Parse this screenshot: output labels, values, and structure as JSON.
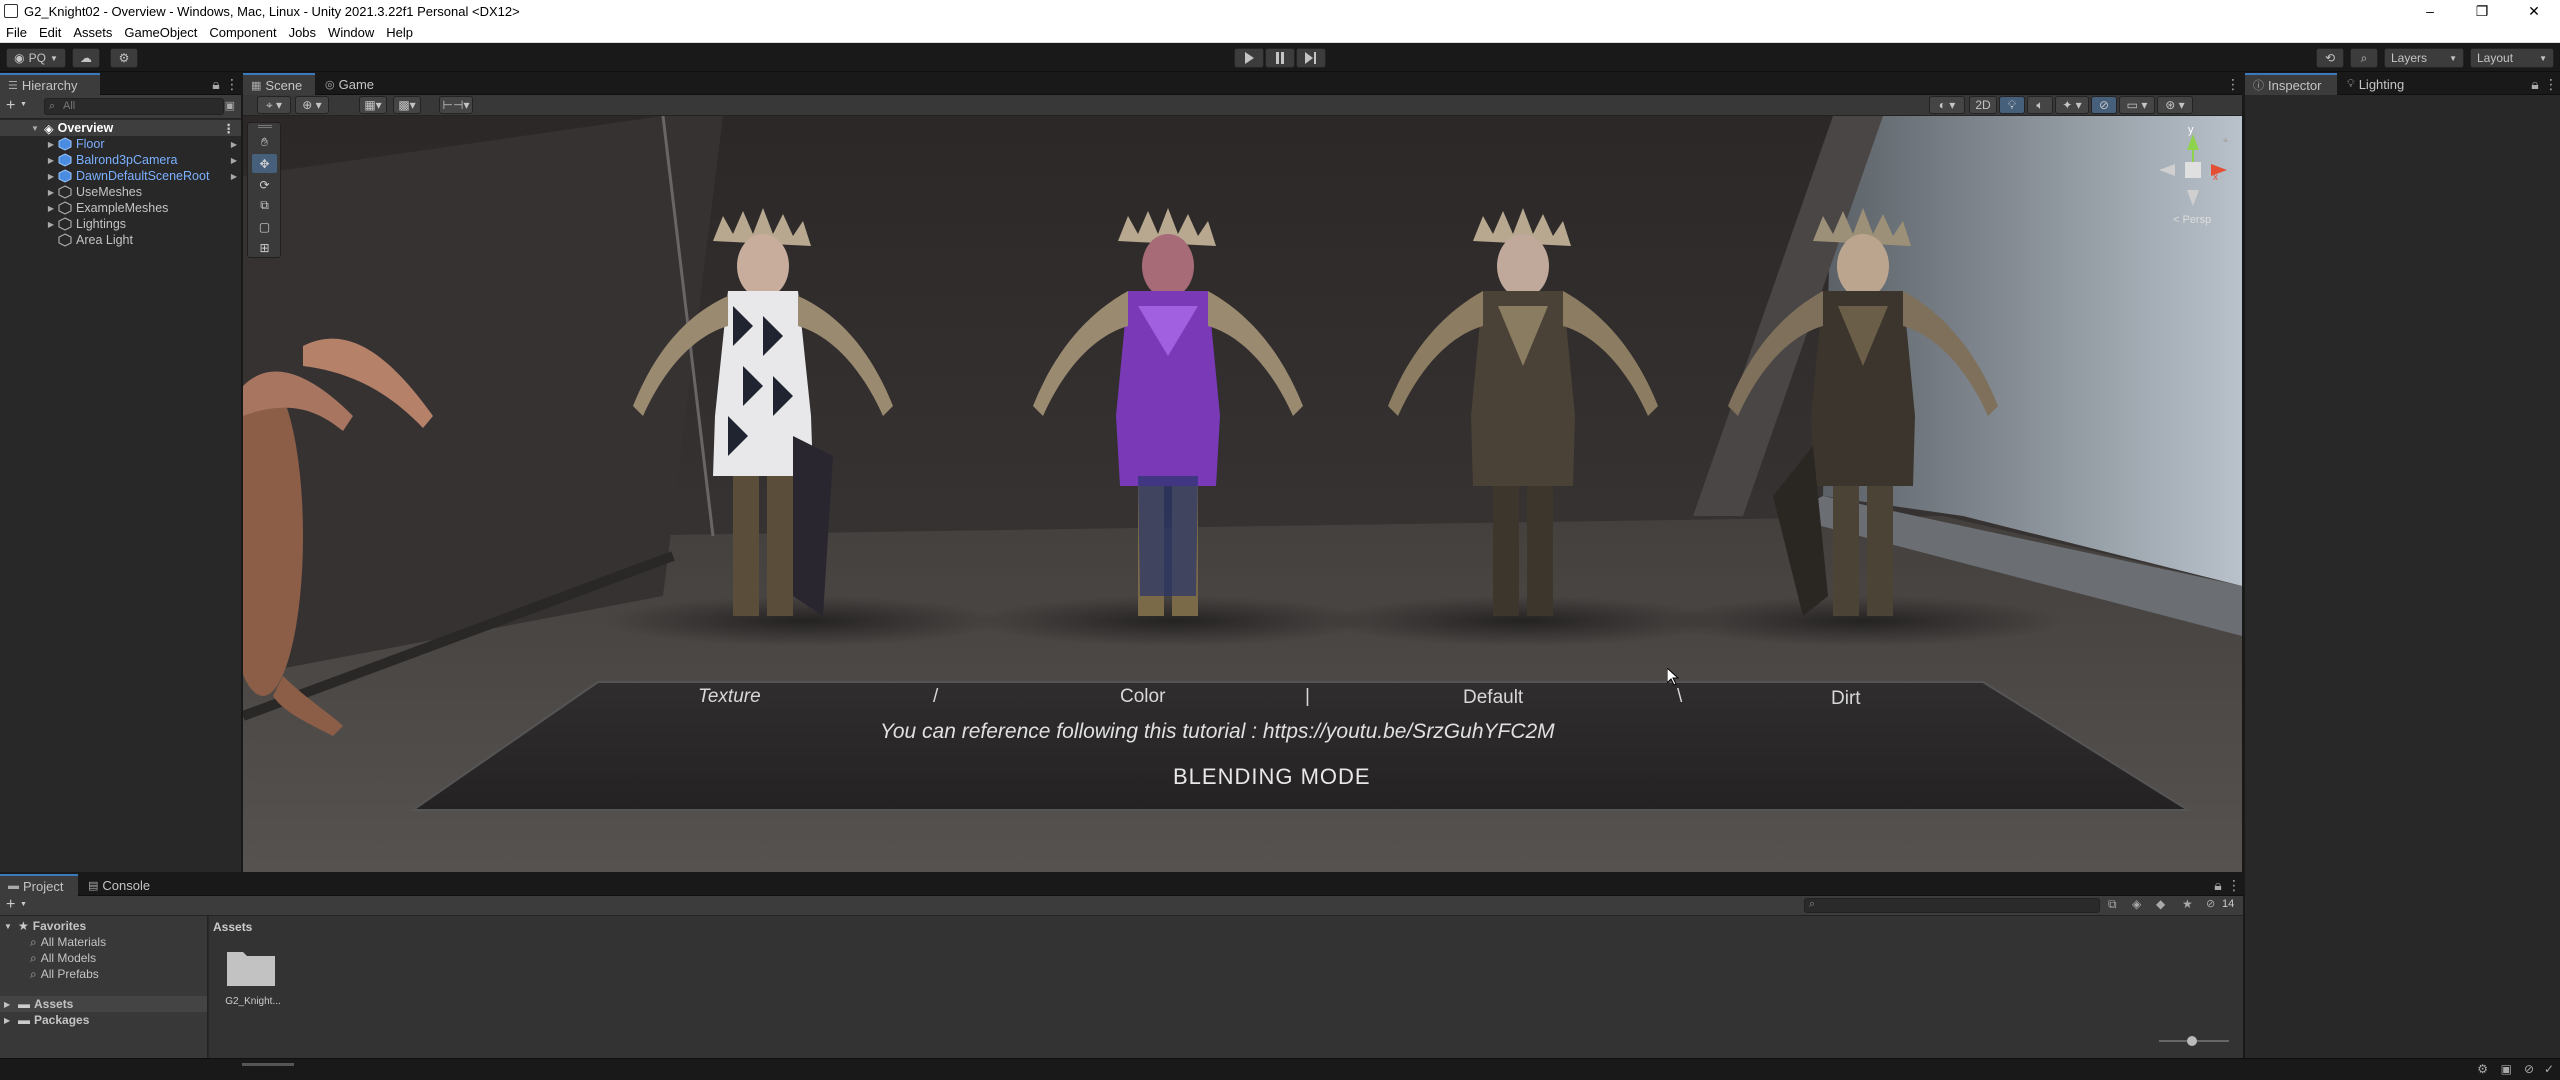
{
  "titlebar": {
    "title": "G2_Knight02 - Overview - Windows, Mac, Linux - Unity 2021.3.22f1 Personal <DX12>",
    "minimize": "–",
    "maximize": "❐",
    "close": "✕"
  },
  "menu": [
    "File",
    "Edit",
    "Assets",
    "GameObject",
    "Component",
    "Jobs",
    "Window",
    "Help"
  ],
  "toolbar": {
    "account_label": "PQ",
    "layers_label": "Layers",
    "layout_label": "Layout"
  },
  "hierarchy": {
    "tab_label": "Hierarchy",
    "search_placeholder": "All",
    "scene_name": "Overview",
    "items": [
      {
        "label": "Floor",
        "prefab": true
      },
      {
        "label": "Balrond3pCamera",
        "prefab": true
      },
      {
        "label": "DawnDefaultSceneRoot",
        "prefab": true
      },
      {
        "label": "UseMeshes",
        "prefab": false
      },
      {
        "label": "ExampleMeshes",
        "prefab": false
      },
      {
        "label": "Lightings",
        "prefab": false
      },
      {
        "label": "Area Light",
        "prefab": false
      }
    ]
  },
  "scene": {
    "tabs": [
      "Scene",
      "Game"
    ],
    "btn_2d": "2D",
    "gizmo_y": "y",
    "gizmo_persp": "< Persp",
    "floor_labels": [
      "Texture",
      "/",
      "Color",
      "|",
      "Default",
      "\\",
      "Dirt"
    ],
    "tutorial_text": "You can reference following this tutorial : https://youtu.be/SrzGuhYFC2M",
    "blending_text": "BLENDING MODE"
  },
  "inspector": {
    "tabs": [
      "Inspector",
      "Lighting"
    ]
  },
  "project": {
    "tabs": [
      "Project",
      "Console"
    ],
    "favorites_label": "Favorites",
    "favorites": [
      "All Materials",
      "All Models",
      "All Prefabs"
    ],
    "roots": [
      "Assets",
      "Packages"
    ],
    "breadcrumb": "Assets",
    "folder_label": "G2_Knight...",
    "count_badge": "14"
  },
  "colors": {
    "accent": "#3a79bb",
    "prefab_text": "#7bb0ff",
    "knight_purple": "#7a3ab8"
  }
}
